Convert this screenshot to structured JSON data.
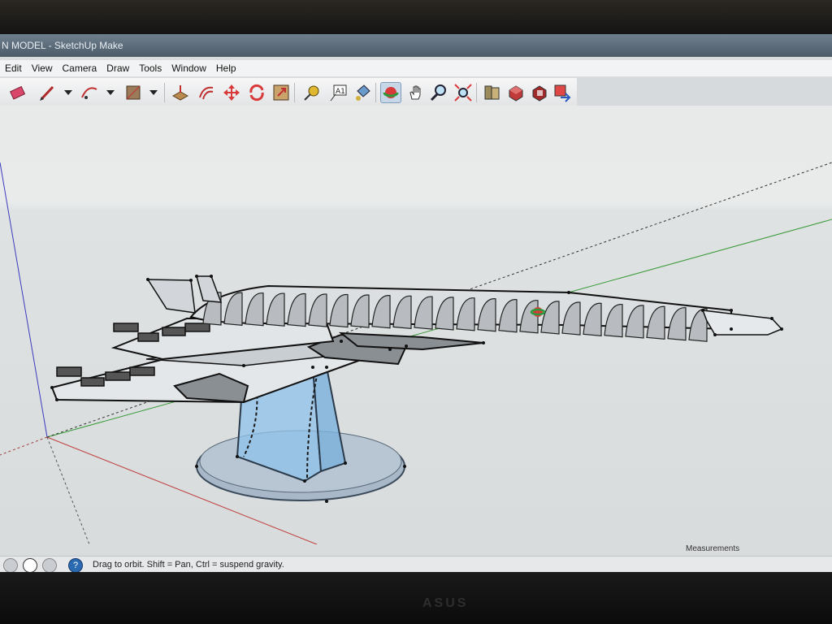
{
  "window": {
    "title": "N MODEL - SketchUp Make"
  },
  "menu": [
    {
      "label": "Edit"
    },
    {
      "label": "View"
    },
    {
      "label": "Camera"
    },
    {
      "label": "Draw"
    },
    {
      "label": "Tools"
    },
    {
      "label": "Window"
    },
    {
      "label": "Help"
    }
  ],
  "toolbar": {
    "tools": [
      {
        "name": "eraser-icon"
      },
      {
        "name": "pencil-icon"
      },
      {
        "name": "arc-icon"
      },
      {
        "name": "rectangle-icon"
      },
      {
        "name": "push-pull-icon"
      },
      {
        "name": "offset-icon"
      },
      {
        "name": "move-icon"
      },
      {
        "name": "rotate-icon"
      },
      {
        "name": "scale-icon"
      },
      {
        "name": "tape-measure-icon"
      },
      {
        "name": "text-icon"
      },
      {
        "name": "paint-bucket-icon"
      },
      {
        "name": "orbit-icon",
        "active": true
      },
      {
        "name": "pan-icon"
      },
      {
        "name": "zoom-icon"
      },
      {
        "name": "zoom-extents-icon"
      },
      {
        "name": "warehouse-icon"
      },
      {
        "name": "components-icon"
      },
      {
        "name": "extensions-icon"
      },
      {
        "name": "share-icon"
      }
    ]
  },
  "status": {
    "text": "Drag to orbit. Shift = Pan, Ctrl = suspend gravity.",
    "measurements_label": "Measurements"
  },
  "colors": {
    "axis_red": "#c04040",
    "axis_green": "#3a9a3a",
    "axis_blue": "#3a3ac0",
    "glass_blue": "#8fc2ea",
    "model_gray": "#8a8f94"
  }
}
